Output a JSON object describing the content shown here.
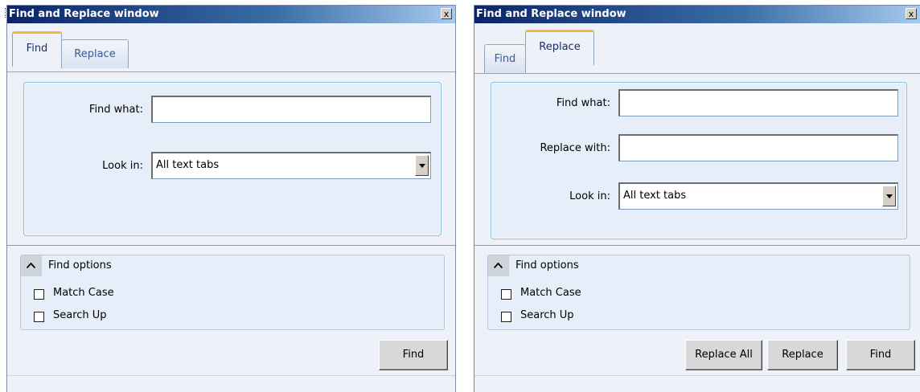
{
  "find_window": {
    "title": "Find and Replace window",
    "close_label": "x",
    "tabs": [
      {
        "label": "Find"
      },
      {
        "label": "Replace"
      }
    ],
    "active_tab": "Find",
    "find_what_label": "Find what:",
    "find_what_value": "",
    "look_in_label": "Look in:",
    "look_in_value": "All text tabs",
    "find_options_label": "Find options",
    "options": [
      {
        "label": "Match Case",
        "checked": false
      },
      {
        "label": "Search Up",
        "checked": false
      }
    ],
    "buttons": {
      "find": "Find"
    }
  },
  "replace_window": {
    "title": "Find and Replace window",
    "close_label": "x",
    "tabs": [
      {
        "label": "Find"
      },
      {
        "label": "Replace"
      }
    ],
    "active_tab": "Replace",
    "find_what_label": "Find what:",
    "find_what_value": "",
    "replace_with_label": "Replace with:",
    "replace_with_value": "",
    "look_in_label": "Look in:",
    "look_in_value": "All text tabs",
    "find_options_label": "Find options",
    "options": [
      {
        "label": "Match Case",
        "checked": false
      },
      {
        "label": "Search Up",
        "checked": false
      }
    ],
    "buttons": {
      "replace_all": "Replace All",
      "replace": "Replace",
      "find": "Find"
    }
  }
}
